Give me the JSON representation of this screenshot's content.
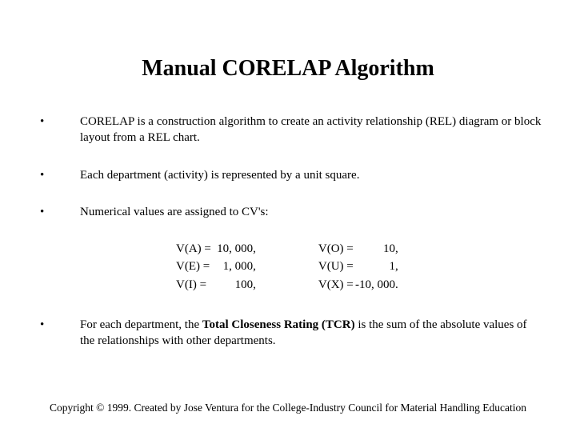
{
  "title": "Manual CORELAP Algorithm",
  "bullets": {
    "b1": "CORELAP is a construction algorithm to create an activity relationship (REL) diagram or block layout from a REL chart.",
    "b2": "Each department (activity) is represented by a unit square.",
    "b3": "Numerical values are assigned to CV's:",
    "b4_pre": "For each department, the ",
    "b4_bold": "Total Closeness Rating (TCR)",
    "b4_post": " is the sum of the absolute values of the relationships with other departments."
  },
  "values": {
    "r1": {
      "l_lab": "V(A) =",
      "l_val": "10, 000,",
      "r_lab": "V(O) =",
      "r_val": "10,"
    },
    "r2": {
      "l_lab": "V(E) =",
      "l_val": "1, 000,",
      "r_lab": "V(U) =",
      "r_val": "1,"
    },
    "r3": {
      "l_lab": "V(I)  =",
      "l_val": "100,",
      "r_lab": "V(X) =",
      "r_val": "-10, 000."
    }
  },
  "footer": "Copyright © 1999.  Created by Jose Ventura for the College-Industry Council for Material Handling Education"
}
